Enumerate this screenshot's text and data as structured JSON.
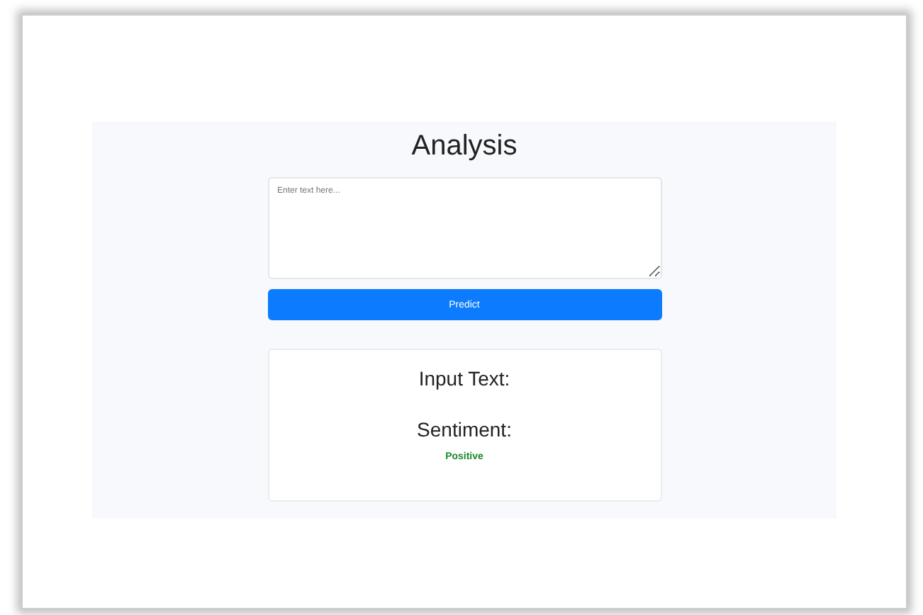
{
  "title": "Analysis",
  "textarea": {
    "placeholder": "Enter text here..."
  },
  "button": "Predict",
  "result": {
    "input_heading": "Input Text:",
    "sentiment_heading": "Sentiment:",
    "sentiment": "Positive"
  }
}
